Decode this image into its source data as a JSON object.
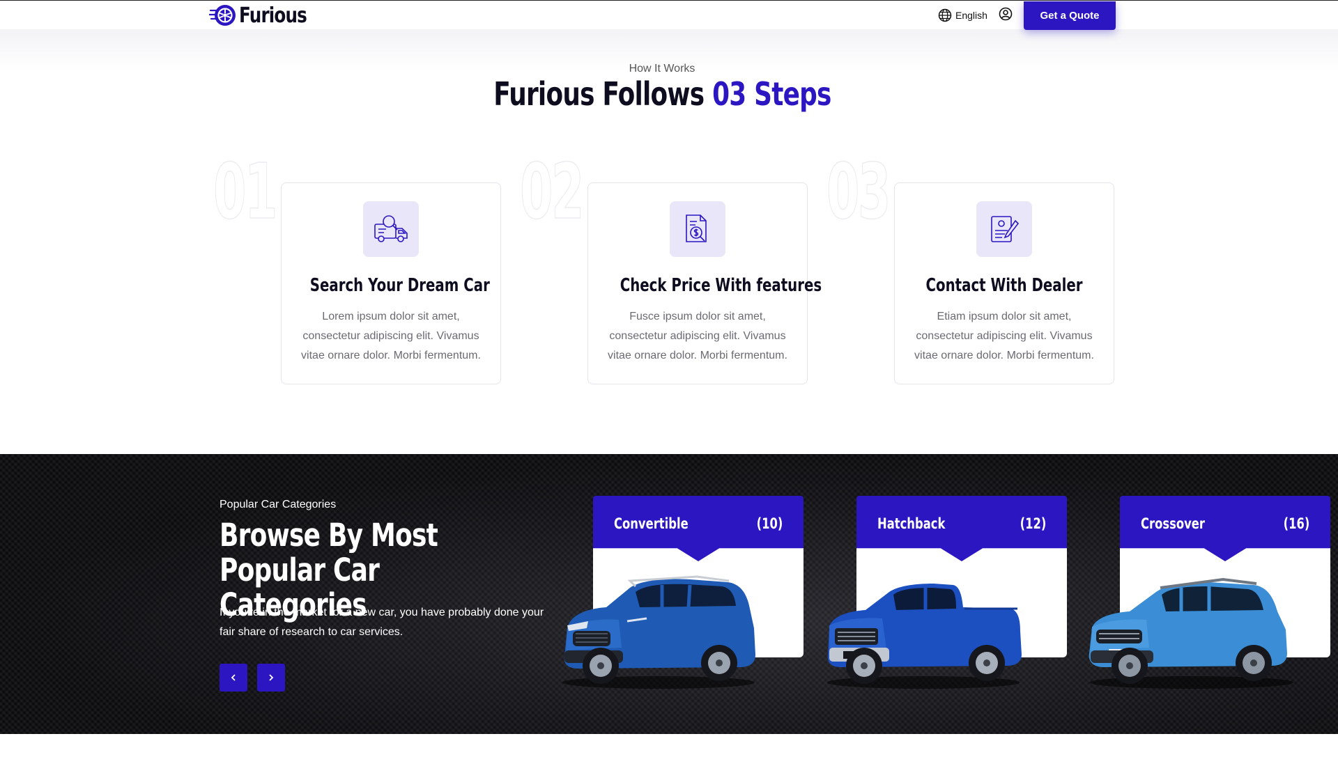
{
  "header": {
    "brand": "Furious",
    "language": "English",
    "cta_label": "Get a Quote"
  },
  "how_it_works": {
    "kicker": "How It Works",
    "title_main": "Furious Follows",
    "title_accent": "03 Steps",
    "steps": [
      {
        "number": "01",
        "icon": "search-truck-icon",
        "title": "Search Your Dream Car",
        "description": "Lorem ipsum dolor sit amet, consectetur adipiscing elit. Vivamus vitae ornare dolor. Morbi fermentum."
      },
      {
        "number": "02",
        "icon": "price-document-icon",
        "title": "Check Price With features",
        "description": "Fusce ipsum dolor sit amet, consectetur adipiscing elit. Vivamus vitae ornare dolor. Morbi fermentum."
      },
      {
        "number": "03",
        "icon": "contract-sign-icon",
        "title": "Contact With Dealer",
        "description": "Etiam ipsum dolor sit amet, consectetur adipiscing elit. Vivamus vitae ornare dolor. Morbi fermentum."
      }
    ]
  },
  "categories": {
    "kicker": "Popular Car Categories",
    "title": "Browse By Most Popular Car Categories",
    "description": "If you’re in the market for a new car, you have probably done your fair share of research to car services.",
    "items": [
      {
        "name": "Convertible",
        "count": "(10)",
        "icon": "blue-suv-image"
      },
      {
        "name": "Hatchback",
        "count": "(12)",
        "icon": "blue-pickup-image"
      },
      {
        "name": "Crossover",
        "count": "(16)",
        "icon": "blue-crossover-image"
      }
    ]
  },
  "colors": {
    "accent": "#2b16c2",
    "dark_bg": "#0b0b0e",
    "icon_bg": "#e8e6f8"
  }
}
